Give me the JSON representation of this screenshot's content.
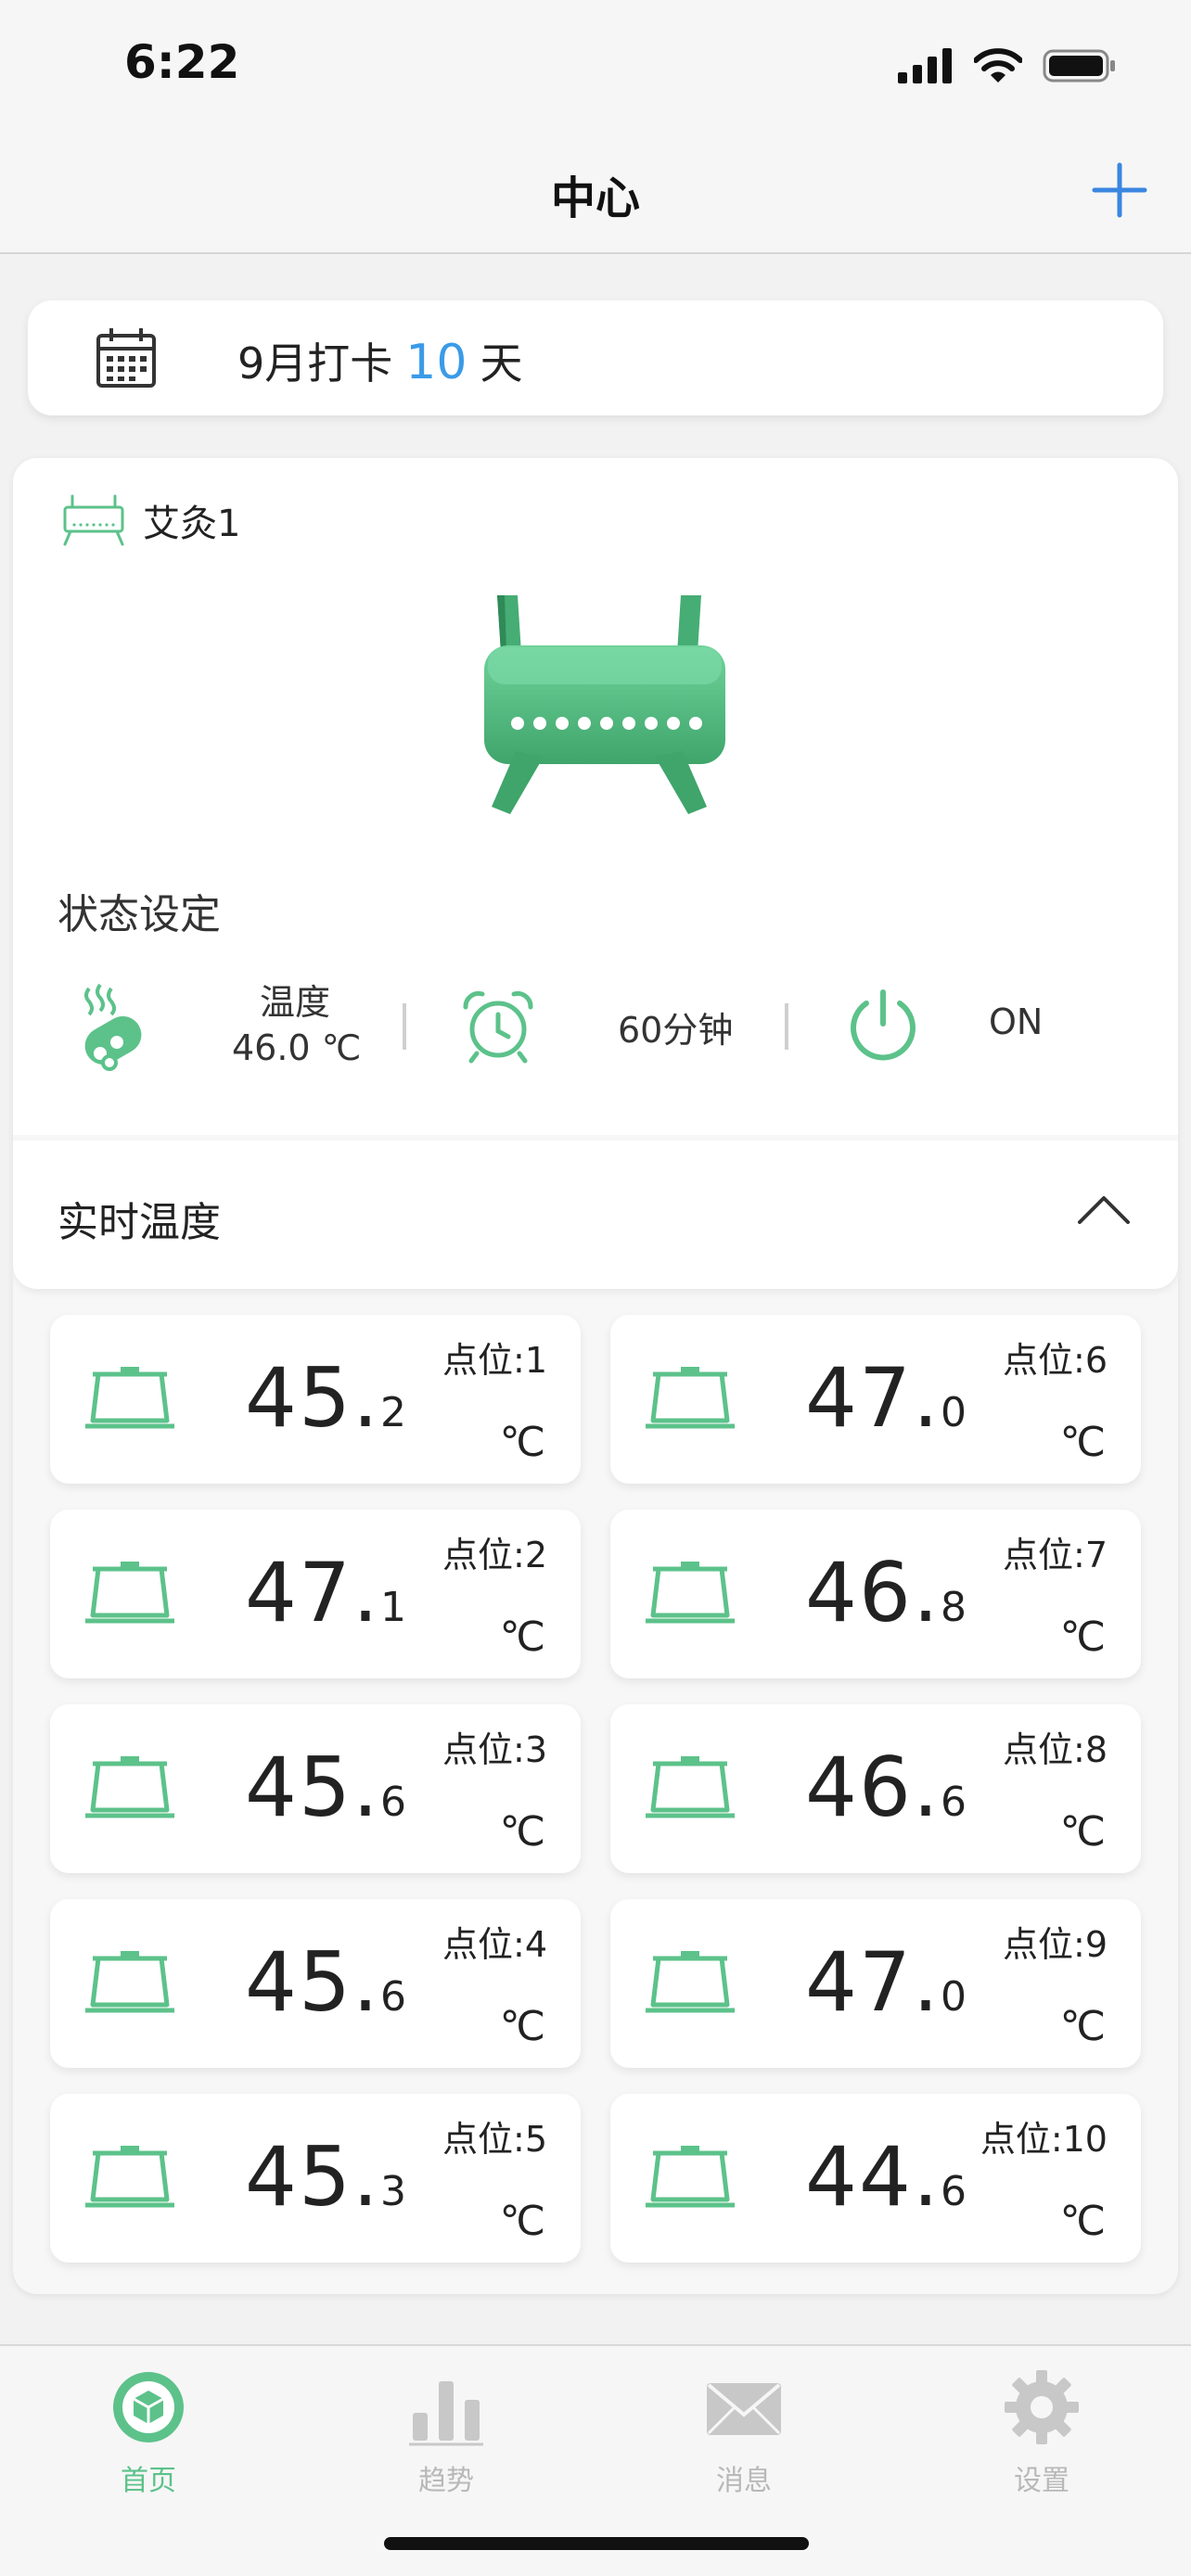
{
  "status_bar": {
    "time": "6:22"
  },
  "nav": {
    "title": "中心"
  },
  "checkin": {
    "prefix": "9月打卡",
    "count": "10",
    "suffix": "天"
  },
  "device": {
    "name": "艾灸1"
  },
  "status_settings": {
    "title": "状态设定",
    "temperature_label": "温度",
    "temperature_value": "46.0 ℃",
    "timer": "60分钟",
    "power": "ON"
  },
  "realtime": {
    "title": "实时温度",
    "unit": "℃",
    "points": [
      {
        "label": "点位:1",
        "int": "45.",
        "dec": "2"
      },
      {
        "label": "点位:6",
        "int": "47.",
        "dec": "0"
      },
      {
        "label": "点位:2",
        "int": "47.",
        "dec": "1"
      },
      {
        "label": "点位:7",
        "int": "46.",
        "dec": "8"
      },
      {
        "label": "点位:3",
        "int": "45.",
        "dec": "6"
      },
      {
        "label": "点位:8",
        "int": "46.",
        "dec": "6"
      },
      {
        "label": "点位:4",
        "int": "45.",
        "dec": "6"
      },
      {
        "label": "点位:9",
        "int": "47.",
        "dec": "0"
      },
      {
        "label": "点位:5",
        "int": "45.",
        "dec": "3"
      },
      {
        "label": "点位:10",
        "int": "44.",
        "dec": "6"
      }
    ]
  },
  "tabs": [
    {
      "label": "首页",
      "icon": "home-icon",
      "active": true
    },
    {
      "label": "趋势",
      "icon": "trend-icon",
      "active": false
    },
    {
      "label": "消息",
      "icon": "message-icon",
      "active": false
    },
    {
      "label": "设置",
      "icon": "settings-icon",
      "active": false
    }
  ],
  "colors": {
    "accent": "#5cc28a",
    "blue": "#3a9be8",
    "inactive": "#b8b8b8"
  }
}
